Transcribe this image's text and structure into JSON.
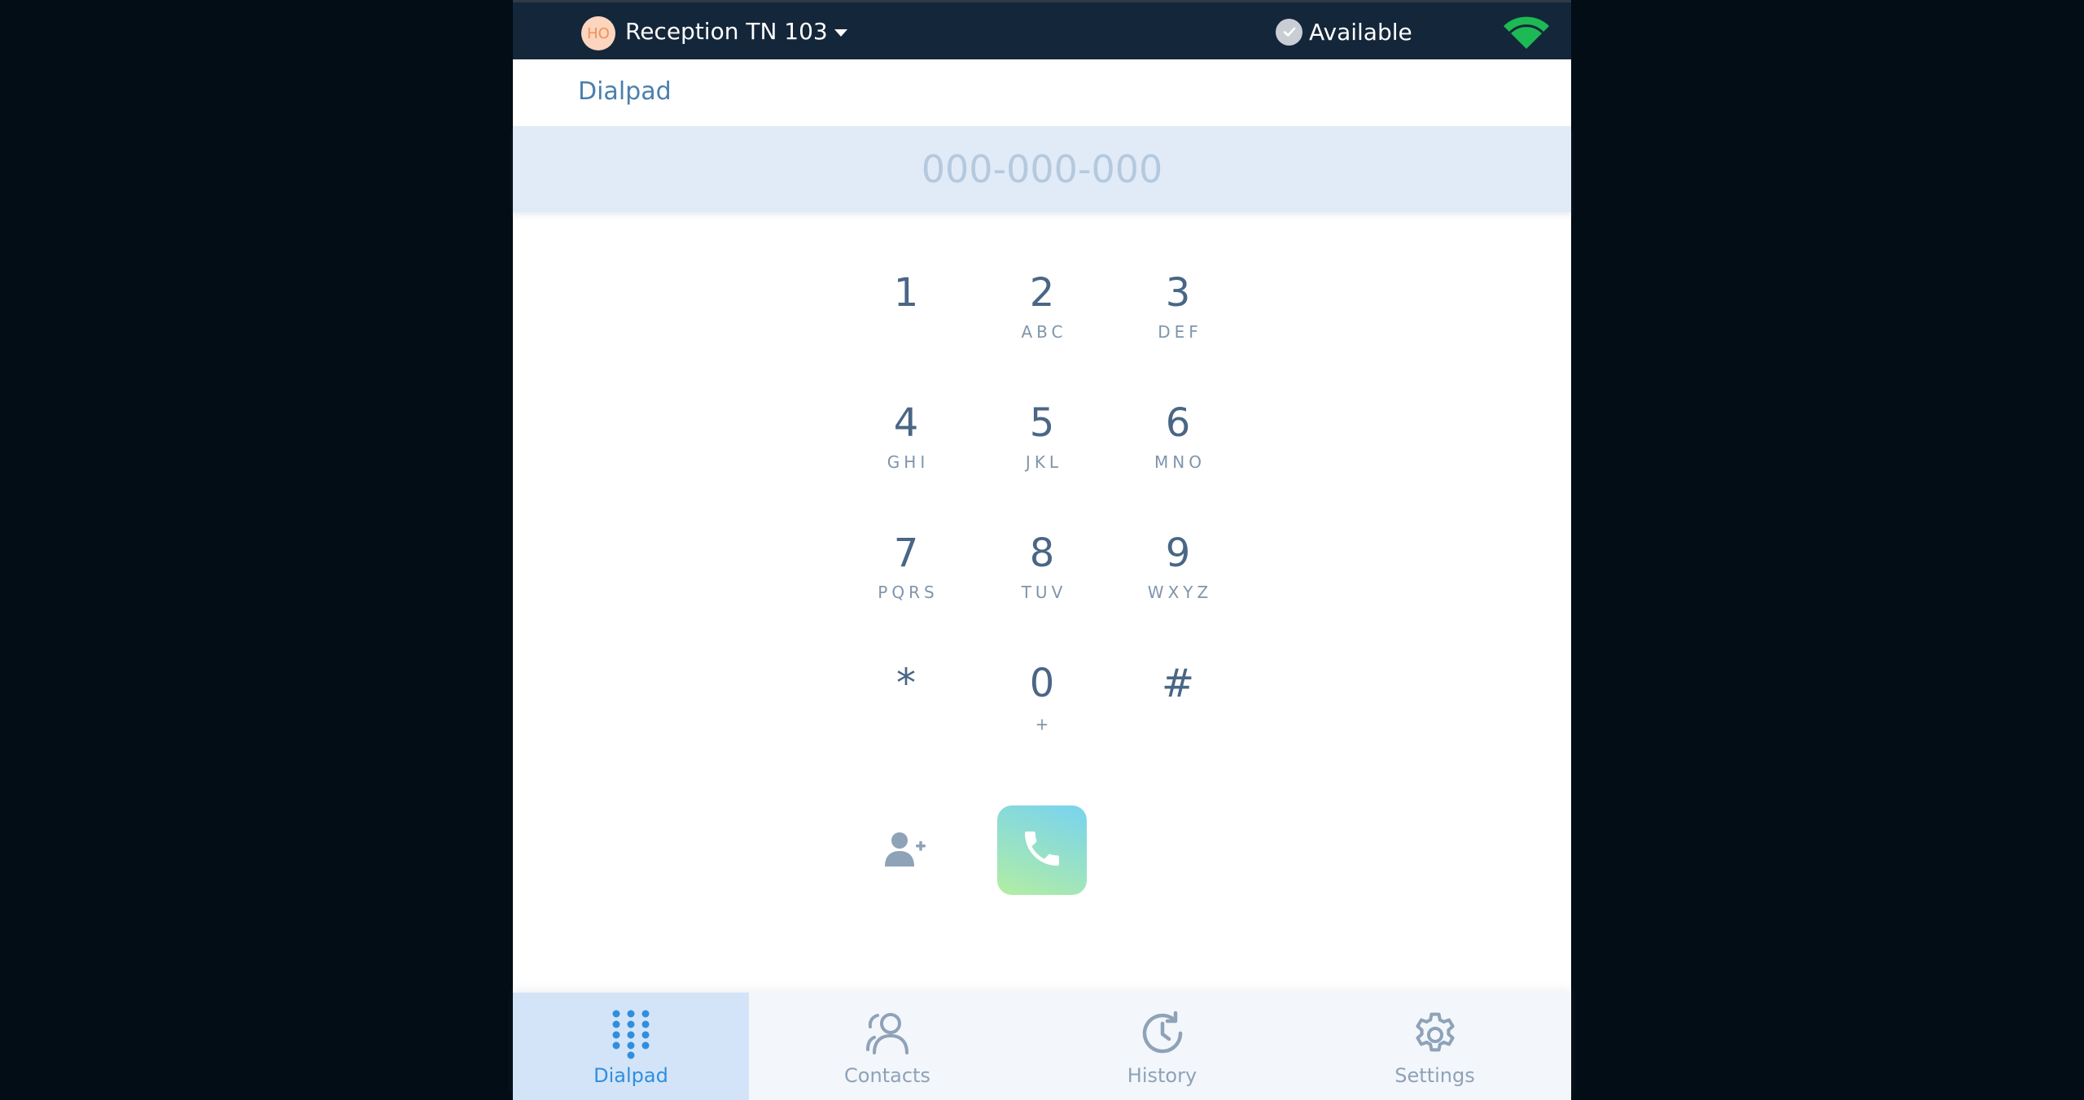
{
  "topbar": {
    "avatar_initials": "HO",
    "account_name": "Reception TN 103",
    "status_label": "Available",
    "connection_icon": "wifi-icon",
    "colors": {
      "background": "#14263a",
      "connection": "#1db954"
    }
  },
  "header": {
    "title": "Dialpad"
  },
  "number_input": {
    "value": "",
    "placeholder": "000-000-000"
  },
  "dialpad": {
    "keys": [
      {
        "digit": "1",
        "letters": ""
      },
      {
        "digit": "2",
        "letters": "ABC"
      },
      {
        "digit": "3",
        "letters": "DEF"
      },
      {
        "digit": "4",
        "letters": "GHI"
      },
      {
        "digit": "5",
        "letters": "JKL"
      },
      {
        "digit": "6",
        "letters": "MNO"
      },
      {
        "digit": "7",
        "letters": "PQRS"
      },
      {
        "digit": "8",
        "letters": "TUV"
      },
      {
        "digit": "9",
        "letters": "WXYZ"
      },
      {
        "digit": "*",
        "letters": ""
      },
      {
        "digit": "0",
        "letters": "+"
      },
      {
        "digit": "#",
        "letters": ""
      }
    ]
  },
  "actions": {
    "add_contact_icon": "add-user-icon",
    "call_icon": "phone-icon",
    "call_colors": [
      "#78d3ef",
      "#b3eea2"
    ]
  },
  "tabs": [
    {
      "label": "Dialpad",
      "icon": "dialpad-grid-icon",
      "active": true
    },
    {
      "label": "Contacts",
      "icon": "contacts-icon",
      "active": false
    },
    {
      "label": "History",
      "icon": "history-icon",
      "active": false
    },
    {
      "label": "Settings",
      "icon": "gear-icon",
      "active": false
    }
  ],
  "theme": {
    "accent": "#2e8fe0",
    "active_tab_bg": "#d4e4f8",
    "input_bg": "#e1ebf7"
  }
}
